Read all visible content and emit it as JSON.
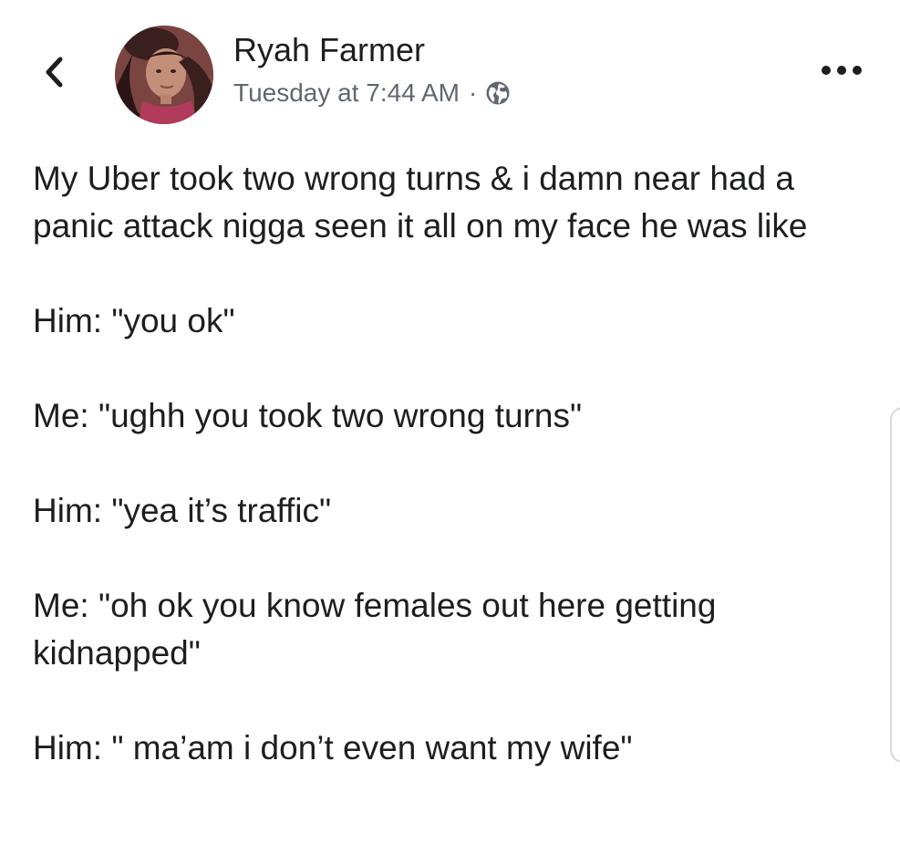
{
  "header": {
    "author_name": "Ryah Farmer",
    "timestamp": "Tuesday at 7:44 AM",
    "separator": "·",
    "back_icon": "chevron-left-icon",
    "privacy_icon": "globe-icon",
    "more_icon": "more-horizontal-icon"
  },
  "post": {
    "paragraphs": [
      "My Uber took two wrong turns & i damn near had a panic attack nigga seen it all on my face he was like",
      "Him: \"you ok\"",
      "Me: \"ughh you took two wrong turns\"",
      "Him: \"yea it’s traffic\"",
      "Me: \"oh ok you know females out here getting kidnapped\"",
      "Him: \" ma’am i don’t even want my wife\""
    ]
  },
  "colors": {
    "text_primary": "#1c1e21",
    "text_secondary": "#606770",
    "background": "#ffffff"
  }
}
